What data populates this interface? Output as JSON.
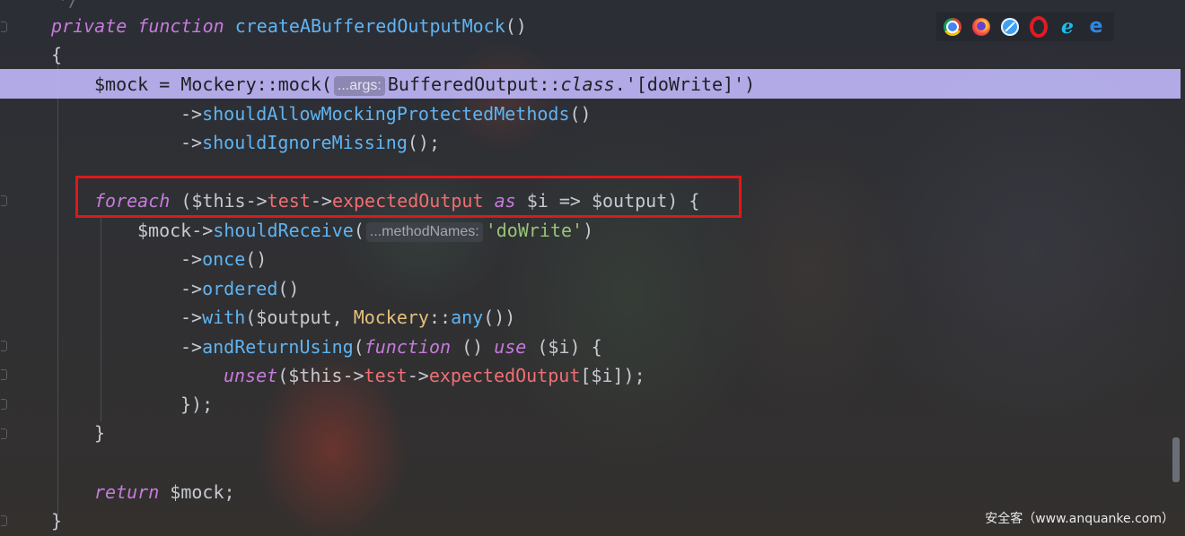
{
  "editor": {
    "top_fragment": "*/",
    "lines": {
      "l1": {
        "t1": "private",
        "t2": " ",
        "t3": "function",
        "t4": " ",
        "t5": "createABufferedOutputMock",
        "t6": "()"
      },
      "l2": {
        "t1": "{"
      },
      "l3": {
        "t1": "$mock = Mockery::mock(",
        "hint": "...args:",
        "t2": "BufferedOutput::",
        "t3": "class",
        "t4": ".'[doWrite]')"
      },
      "l4": {
        "t1": "->",
        "t2": "shouldAllowMockingProtectedMethods",
        "t3": "()"
      },
      "l5": {
        "t1": "->",
        "t2": "shouldIgnoreMissing",
        "t3": "();"
      },
      "l6": {
        "t1": "foreach",
        "t2": " ($this->",
        "t3": "test",
        "t4": "->",
        "t5": "expectedOutput",
        "t6": " ",
        "t7": "as",
        "t8": " $i => $output) {"
      },
      "l7": {
        "t1": "$mock->",
        "t2": "shouldReceive",
        "t3": "(",
        "hint": "...methodNames:",
        "t4": "'doWrite'",
        "t5": ")"
      },
      "l8": {
        "t1": "->",
        "t2": "once",
        "t3": "()"
      },
      "l9": {
        "t1": "->",
        "t2": "ordered",
        "t3": "()"
      },
      "l10": {
        "t1": "->",
        "t2": "with",
        "t3": "($output, ",
        "t4": "Mockery",
        "t5": "::",
        "t6": "any",
        "t7": "())"
      },
      "l11": {
        "t1": "->",
        "t2": "andReturnUsing",
        "t3": "(",
        "t4": "function",
        "t5": " () ",
        "t6": "use",
        "t7": " ($i) {"
      },
      "l12": {
        "t1": "unset",
        "t2": "($this->",
        "t3": "test",
        "t4": "->",
        "t5": "expectedOutput",
        "t6": "[$i]);"
      },
      "l13": {
        "t1": "});"
      },
      "l14": {
        "t1": "}"
      },
      "l15": {
        "t1": "return",
        "t2": " $mock;"
      },
      "l16": {
        "t1": "}"
      }
    }
  },
  "browser_icons": [
    "chrome-icon",
    "firefox-icon",
    "safari-icon",
    "opera-icon",
    "ie-icon",
    "edge-icon"
  ],
  "icon_glyphs": {
    "ie": "e",
    "edge": "e"
  },
  "watermark": "安全客（www.anquanke.com）",
  "colors": {
    "keyword": "#c67bdc",
    "function": "#5fb4f2",
    "property": "#f06e73",
    "class": "#e5c07b",
    "string": "#98c379",
    "highlight_line": "#c4bcff",
    "annotation_box": "#e01818"
  }
}
